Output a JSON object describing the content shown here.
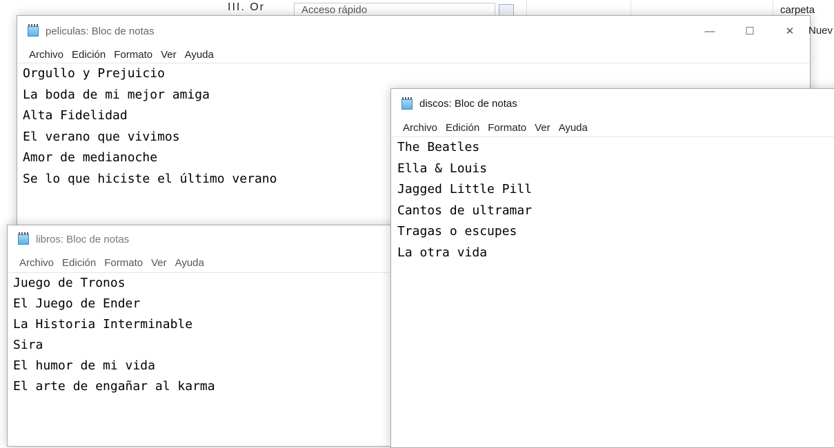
{
  "background": {
    "roman_text": "III.  Or",
    "quick_access": "Acceso rápido",
    "carpeta": "carpeta",
    "nuevo_fragment": "Nuev"
  },
  "windows": {
    "peliculas": {
      "title": "peliculas: Bloc de notas",
      "menu": [
        "Archivo",
        "Edición",
        "Formato",
        "Ver",
        "Ayuda"
      ],
      "lines": [
        "Orgullo y Prejuicio",
        "La boda de mi mejor amiga",
        "Alta Fidelidad",
        "El verano que vivimos",
        "Amor de medianoche",
        "Se lo que hiciste el último verano"
      ],
      "controls": {
        "minimize": "—",
        "maximize": "☐",
        "close": "✕"
      }
    },
    "libros": {
      "title": "libros: Bloc de notas",
      "menu": [
        "Archivo",
        "Edición",
        "Formato",
        "Ver",
        "Ayuda"
      ],
      "lines": [
        "Juego de Tronos",
        "El Juego de Ender",
        "La Historia Interminable",
        "Sira",
        "El humor de mi vida",
        "El arte de engañar al karma"
      ]
    },
    "discos": {
      "title": "discos: Bloc de notas",
      "menu": [
        "Archivo",
        "Edición",
        "Formato",
        "Ver",
        "Ayuda"
      ],
      "lines": [
        "The Beatles",
        "Ella & Louis",
        "Jagged Little Pill",
        "Cantos de ultramar",
        "Tragas o escupes",
        "La otra vida"
      ]
    }
  }
}
